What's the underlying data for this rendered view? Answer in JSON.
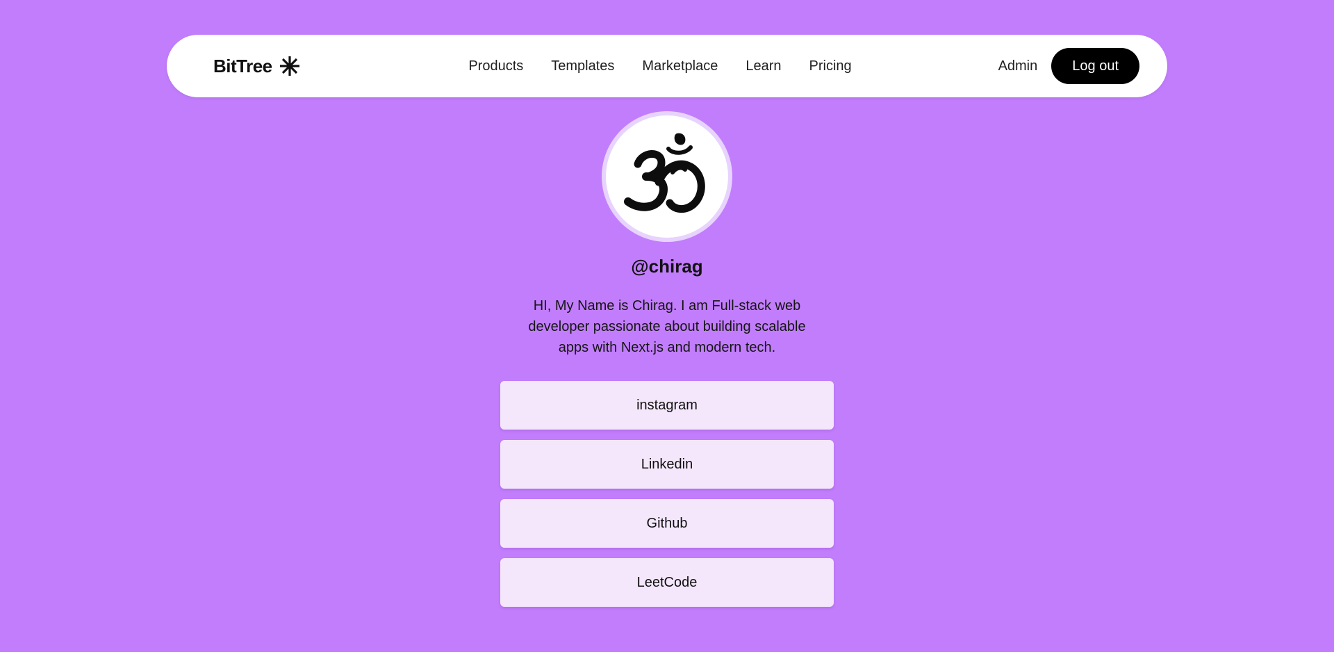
{
  "nav": {
    "brand": "BitTree",
    "links": [
      "Products",
      "Templates",
      "Marketplace",
      "Learn",
      "Pricing"
    ],
    "admin": "Admin",
    "logout": "Log out"
  },
  "profile": {
    "username": "@chirag",
    "bio": "HI, My Name is Chirag. I am Full-stack web developer passionate about building scalable apps with Next.js and modern tech.",
    "avatar_icon": "om-symbol-icon"
  },
  "links": [
    "instagram",
    "Linkedin",
    "Github",
    "LeetCode"
  ],
  "colors": {
    "background": "#c27dfc",
    "navbar": "#ffffff",
    "button_dark": "#000000",
    "link_card": "#f4e7fc",
    "avatar_ring": "#e7d3fd"
  }
}
